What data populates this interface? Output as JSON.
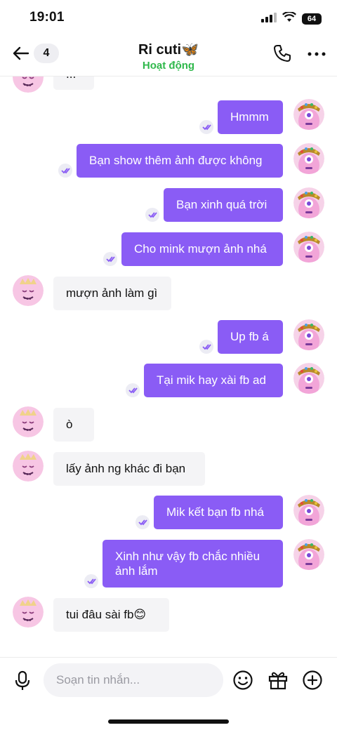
{
  "status_bar": {
    "time": "19:01",
    "battery": "64"
  },
  "header": {
    "back_icon": "arrow-left-icon",
    "unread_count": "4",
    "contact_name": "Ri cuti🦋",
    "contact_status": "Hoạt động",
    "call_icon": "phone-icon",
    "more_icon": "more-icon"
  },
  "messages": [
    {
      "from": "them",
      "text": "..."
    },
    {
      "from": "me",
      "text": "Hmmm",
      "read": true
    },
    {
      "from": "me",
      "text": "Bạn show thêm ảnh được không",
      "read": true
    },
    {
      "from": "me",
      "text": "Bạn xinh quá trời",
      "read": true
    },
    {
      "from": "me",
      "text": "Cho mink mượn ảnh nhá",
      "read": true
    },
    {
      "from": "them",
      "text": "mượn ảnh làm gì"
    },
    {
      "from": "me",
      "text": "Up fb á",
      "read": true
    },
    {
      "from": "me",
      "text": "Tại mik hay xài fb ad",
      "read": true
    },
    {
      "from": "them",
      "text": "ò"
    },
    {
      "from": "them",
      "text": "lấy ảnh ng khác đi bạn"
    },
    {
      "from": "me",
      "text": "Mik kết bạn fb nhá",
      "read": true
    },
    {
      "from": "me",
      "text": "Xinh như vậy fb chắc nhiều ảnh lắm",
      "read": true
    },
    {
      "from": "them",
      "text": "tui đâu sài fb😊"
    }
  ],
  "composer": {
    "placeholder": "Soạn tin nhắn...",
    "mic_icon": "microphone-icon",
    "emoji_icon": "emoji-icon",
    "gift_icon": "gift-icon",
    "add_icon": "plus-icon"
  },
  "colors": {
    "accent": "#8a5cf5",
    "incoming_bubble": "#f4f4f6",
    "online_status": "#2fb84b"
  }
}
